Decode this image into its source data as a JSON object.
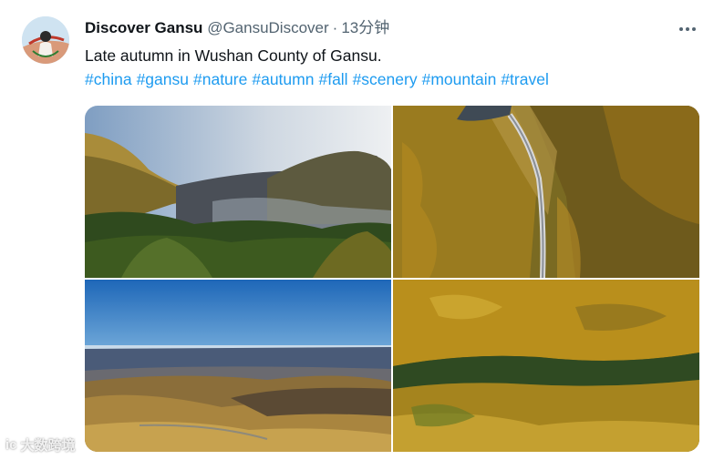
{
  "tweet": {
    "author_name": "Discover Gansu",
    "handle": "@GansuDiscover",
    "separator": "·",
    "time": "13分钟",
    "text": "Late autumn in Wushan County of Gansu.",
    "hashtags": [
      "#china",
      "#gansu",
      "#nature",
      "#autumn",
      "#fall",
      "#scenery",
      "#mountain",
      "#travel"
    ]
  },
  "icons": {
    "more": "more-horizontal-icon",
    "avatar": "profile-avatar"
  },
  "watermark": {
    "logo": "ic",
    "text": "大数跨境"
  },
  "colors": {
    "text_primary": "#0f1419",
    "text_secondary": "#536471",
    "link": "#1d9bf0"
  }
}
